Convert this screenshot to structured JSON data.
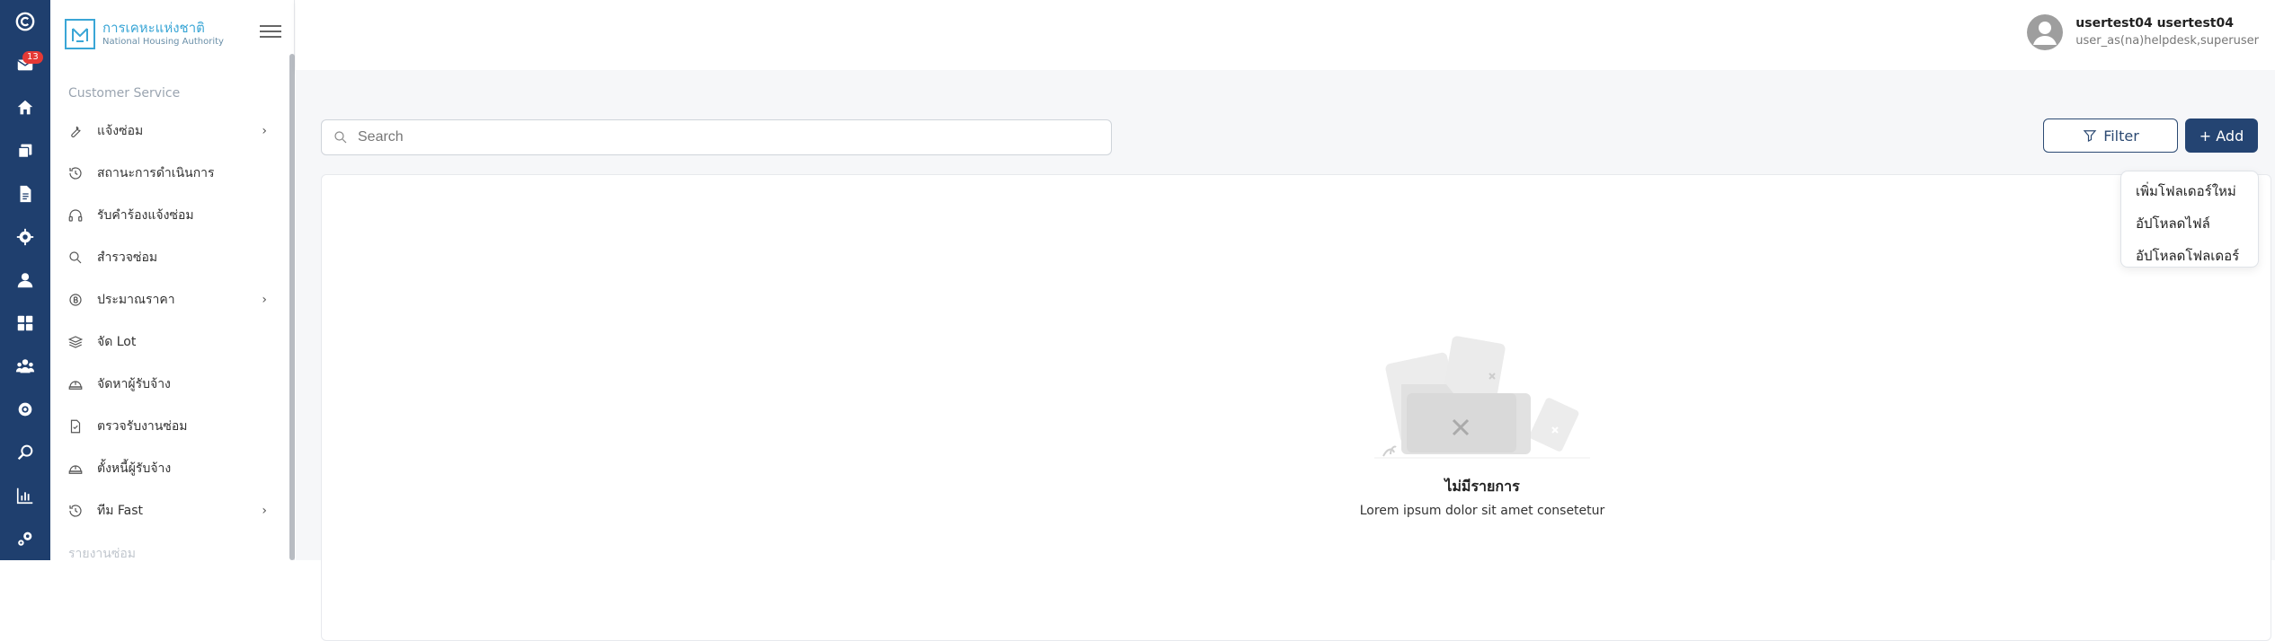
{
  "rail": {
    "notification_count": "13",
    "icons": [
      "logo-icon",
      "mail-icon",
      "home-icon",
      "documents-icon",
      "file-icon",
      "gear-icon",
      "user-icon",
      "dashboard-icon",
      "team-icon",
      "settings-icon",
      "search-icon",
      "chart-icon",
      "tools-icon"
    ]
  },
  "brand": {
    "thai": "การเคหะแห่งชาติ",
    "english": "National Housing Authority"
  },
  "sidebar": {
    "section_title": "Customer Service",
    "items": [
      {
        "label": "แจ้งซ่อม",
        "icon": "wrench-icon",
        "has_submenu": true
      },
      {
        "label": "สถานะการดำเนินการ",
        "icon": "history-icon",
        "has_submenu": false
      },
      {
        "label": "รับคำร้องแจ้งซ่อม",
        "icon": "headset-icon",
        "has_submenu": false
      },
      {
        "label": "สำรวจซ่อม",
        "icon": "search-icon",
        "has_submenu": false
      },
      {
        "label": "ประมาณราคา",
        "icon": "baht-icon",
        "has_submenu": true
      },
      {
        "label": "จัด Lot",
        "icon": "layers-icon",
        "has_submenu": false
      },
      {
        "label": "จัดหาผู้รับจ้าง",
        "icon": "helmet-icon",
        "has_submenu": false
      },
      {
        "label": "ตรวจรับงานซ่อม",
        "icon": "document-check-icon",
        "has_submenu": false
      },
      {
        "label": "ตั้งหนี้ผู้รับจ้าง",
        "icon": "helmet-icon",
        "has_submenu": false
      },
      {
        "label": "ทีม Fast",
        "icon": "clock-icon",
        "has_submenu": true
      }
    ],
    "next_section": "รายงานซ่อม"
  },
  "header": {
    "user_name": "usertest04 usertest04",
    "user_role": "user_as(na)helpdesk,superuser"
  },
  "toolbar": {
    "search_placeholder": "Search",
    "filter_label": "Filter",
    "add_label": "+ Add"
  },
  "add_menu": {
    "items": [
      "เพิ่มโฟลเดอร์ใหม่",
      "อัปโหลดไฟล์",
      "อัปโหลดโฟลเดอร์"
    ]
  },
  "empty_state": {
    "title": "ไม่มีรายการ",
    "description": "Lorem ipsum dolor sit amet consetetur"
  }
}
